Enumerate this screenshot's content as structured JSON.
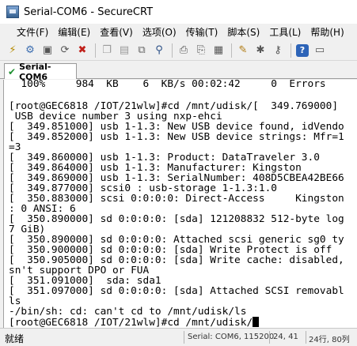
{
  "window": {
    "title": "Serial-COM6 - SecureCRT"
  },
  "menu": [
    "文件(F)",
    "编辑(E)",
    "查看(V)",
    "选项(O)",
    "传输(T)",
    "脚本(S)",
    "工具(L)",
    "帮助(H)"
  ],
  "toolbar_icons": [
    "connect-icon",
    "quick-connect-icon",
    "connect-in-tab-icon",
    "reconnect-icon",
    "disconnect-icon",
    "copy-icon",
    "paste-icon",
    "copy-paste-icon",
    "find-icon",
    "print-icon",
    "print-selection-icon",
    "print-setup-icon",
    "session-options-icon",
    "global-options-icon",
    "keymap-icon",
    "help-icon",
    "help-topics-icon"
  ],
  "tab": {
    "label": "Serial-COM6"
  },
  "terminal": {
    "lines": [
      "  100%     984  KB    6  KB/s 00:02:42     0  Errors",
      "",
      "[root@GEC6818 /IOT/21wlw]#cd /mnt/udisk/[  349.769000]",
      " USB device number 3 using nxp-ehci",
      "[  349.851000] usb 1-1.3: New USB device found, idVendo",
      "[  349.852000] usb 1-1.3: New USB device strings: Mfr=1",
      "=3",
      "[  349.860000] usb 1-1.3: Product: DataTraveler 3.0",
      "[  349.864000] usb 1-1.3: Manufacturer: Kingston",
      "[  349.869000] usb 1-1.3: SerialNumber: 408D5CBEA42BE66",
      "[  349.877000] scsi0 : usb-storage 1-1.3:1.0",
      "[  350.883000] scsi 0:0:0:0: Direct-Access     Kingston",
      ": 0 ANSI: 6",
      "[  350.890000] sd 0:0:0:0: [sda] 121208832 512-byte log",
      "7 GiB)",
      "[  350.890000] sd 0:0:0:0: Attached scsi generic sg0 ty",
      "[  350.900000] sd 0:0:0:0: [sda] Write Protect is off",
      "[  350.905000] sd 0:0:0:0: [sda] Write cache: disabled,",
      "sn't support DPO or FUA",
      "[  351.091000]  sda: sda1",
      "[  351.097000] sd 0:0:0:0: [sda] Attached SCSI removabl",
      "ls",
      "-/bin/sh: cd: can't cd to /mnt/udisk/ls",
      "[root@GEC6818 /IOT/21wlw]#cd /mnt/udisk/"
    ]
  },
  "status": {
    "ready": "就绪",
    "connection": "Serial: COM6, 115200",
    "position": "24,  41",
    "size": "24行, 80列"
  }
}
